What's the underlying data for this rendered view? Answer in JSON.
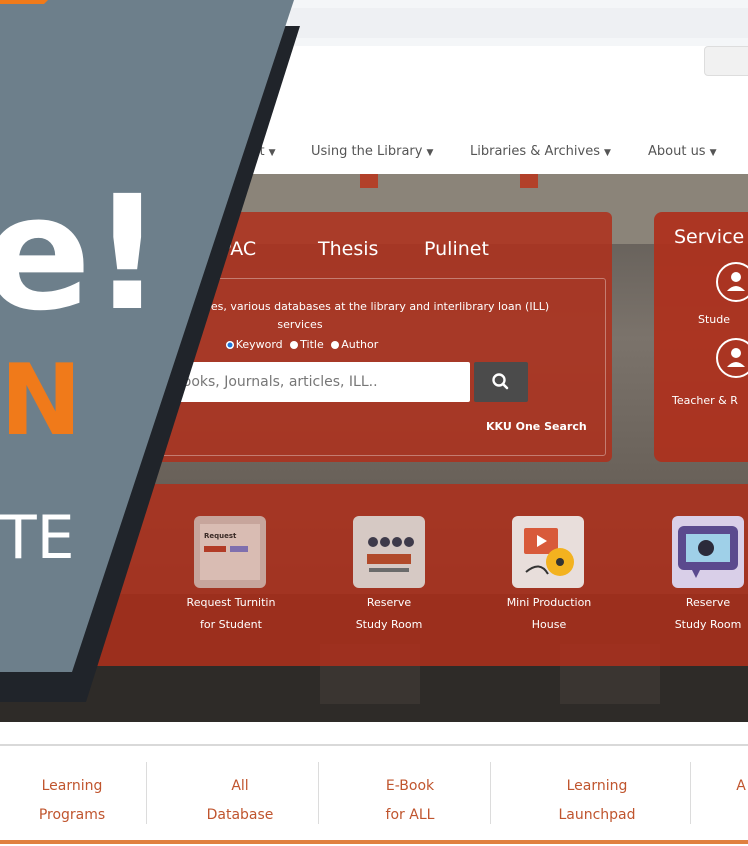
{
  "nav": {
    "items": [
      {
        "label": "port"
      },
      {
        "label": "Using the Library"
      },
      {
        "label": "Libraries & Archives"
      },
      {
        "label": "About us"
      }
    ]
  },
  "search": {
    "tabs": [
      "OPAC",
      "Thesis",
      "Pulinet"
    ],
    "description_line1": "es, various databases at the library and interlibrary loan (ILL)",
    "description_line2": "services",
    "radio_keyword": "Keyword",
    "radio_title": "Title",
    "radio_author": "Author",
    "placeholder": "e-Books, Journals, articles, ILL..",
    "one_search_link": "KKU One Search"
  },
  "services_panel": {
    "title": "Service",
    "items": [
      {
        "label": "Stude"
      },
      {
        "label": "Teacher & R"
      }
    ]
  },
  "services": [
    {
      "line1": "Request Turnitin",
      "line2": "for Student",
      "thumb_label": "Request"
    },
    {
      "line1": "Reserve",
      "line2": "Study Room"
    },
    {
      "line1": "Mini Production",
      "line2": "House"
    },
    {
      "line1": "Reserve",
      "line2": "Study Room"
    }
  ],
  "overlay": {
    "line1": "e!",
    "line2": "N",
    "line3": "TE"
  },
  "footer": {
    "links": [
      {
        "line1": "Learning",
        "line2": "Programs"
      },
      {
        "line1": "All",
        "line2": "Database"
      },
      {
        "line1": "E-Book",
        "line2": "for ALL"
      },
      {
        "line1": "Learning",
        "line2": "Launchpad"
      },
      {
        "line1": "A",
        "line2": ""
      }
    ]
  },
  "colors": {
    "brand_red": "#af301c",
    "overlay_slate": "#6d7f8b",
    "overlay_orange": "#f07a1a",
    "footer_link": "#c0552e"
  }
}
